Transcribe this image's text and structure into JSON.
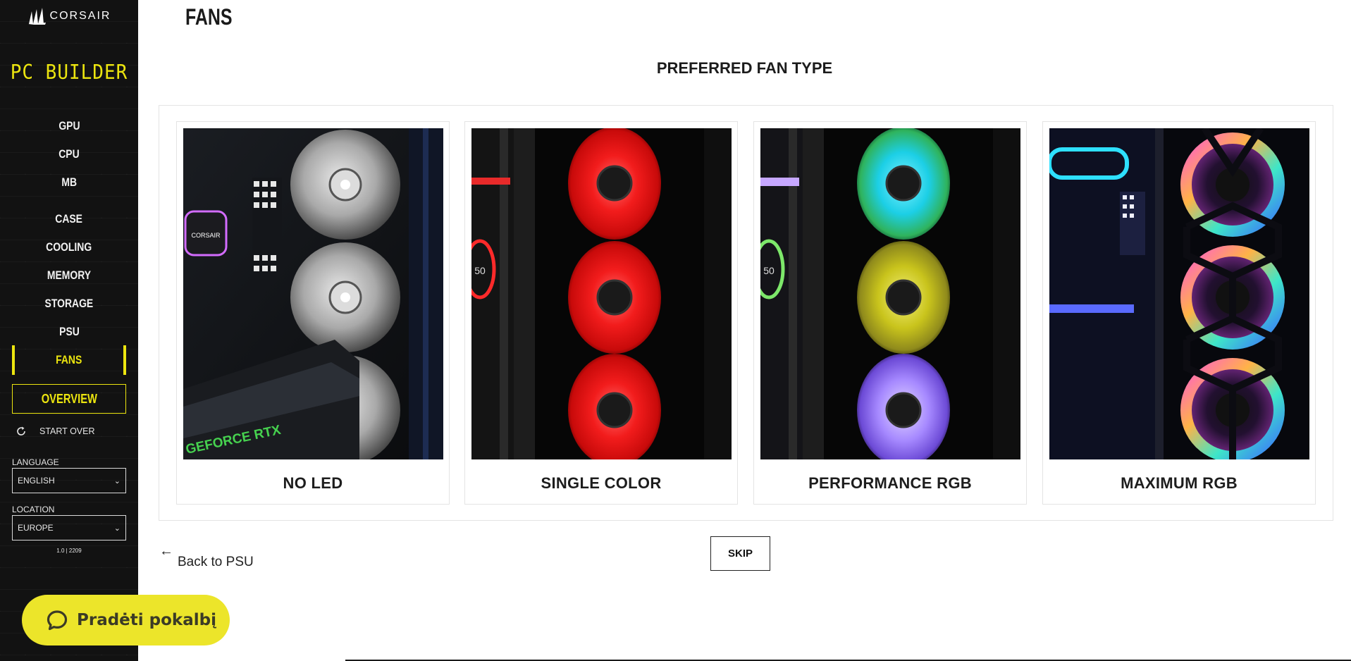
{
  "sidebar": {
    "brand": "CORSAIR",
    "app_title": "PC BUILDER",
    "nav": [
      {
        "label": "GPU",
        "active": false
      },
      {
        "label": "CPU",
        "active": false
      },
      {
        "label": "MB",
        "active": false
      },
      {
        "label": "CASE",
        "active": false
      },
      {
        "label": "COOLING",
        "active": false
      },
      {
        "label": "MEMORY",
        "active": false
      },
      {
        "label": "STORAGE",
        "active": false
      },
      {
        "label": "PSU",
        "active": false
      },
      {
        "label": "FANS",
        "active": true
      }
    ],
    "overview_label": "OVERVIEW",
    "start_over_label": "START OVER",
    "language_label": "LANGUAGE",
    "language_value": "ENGLISH",
    "location_label": "LOCATION",
    "location_value": "EUROPE",
    "version": "1.0 | 2209"
  },
  "main": {
    "page_title": "FANS",
    "section_title": "PREFERRED FAN TYPE",
    "options": [
      {
        "label": "NO LED",
        "image": "white-fans-no-led"
      },
      {
        "label": "SINGLE COLOR",
        "image": "red-fans-single-color"
      },
      {
        "label": "PERFORMANCE RGB",
        "image": "rgb-fans-performance"
      },
      {
        "label": "MAXIMUM RGB",
        "image": "rgb-fans-maximum"
      }
    ],
    "back_label": "Back to PSU",
    "skip_label": "SKIP"
  },
  "chat": {
    "label": "Pradėti pokalbį"
  },
  "colors": {
    "accent_yellow": "#ece50f",
    "sidebar_bg": "#121212",
    "chat_bg": "#ece52a"
  }
}
